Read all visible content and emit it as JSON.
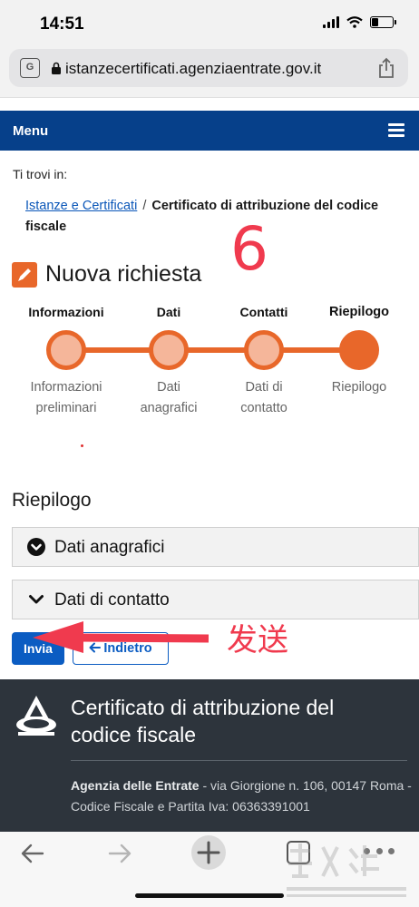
{
  "status_bar": {
    "time": "14:51",
    "battery_level": 0.3
  },
  "browser": {
    "url": "istanzecertificati.agenziaentrate.gov.it",
    "translate_icon": "translate-icon",
    "lock_icon": "lock-icon",
    "share_icon": "share-icon"
  },
  "menu": {
    "label": "Menu",
    "icon": "hamburger-icon"
  },
  "breadcrumb": {
    "intro": "Ti trovi in:",
    "link": "Istanze e Certificati",
    "separator": "/",
    "current": "Certificato di attribuzione del codice fiscale"
  },
  "annotations": {
    "step_number": "6",
    "send_note": "发送"
  },
  "page": {
    "title": "Nuova richiesta",
    "title_icon": "pencil-icon"
  },
  "stepper": {
    "steps": [
      {
        "title": "Informazioni",
        "subtitle_1": "Informazioni",
        "subtitle_2": "preliminari"
      },
      {
        "title": "Dati",
        "subtitle_1": "Dati",
        "subtitle_2": "anagrafici"
      },
      {
        "title": "Contatti",
        "subtitle_1": "Dati di",
        "subtitle_2": "contatto"
      },
      {
        "title": "Riepilogo",
        "subtitle_1": "Riepilogo",
        "subtitle_2": ""
      }
    ],
    "active_step": 4
  },
  "summary": {
    "title": "Riepilogo",
    "sections": [
      {
        "label": "Dati anagrafici",
        "icon": "circle-chevron-down-icon"
      },
      {
        "label": "Dati di contatto",
        "icon": "chevron-down-icon"
      }
    ]
  },
  "actions": {
    "submit": "Invia",
    "back": "Indietro",
    "back_icon": "arrow-left-icon"
  },
  "footer": {
    "title": "Certificato di attribuzione del codice fiscale",
    "org": "Agenzia delle Entrate",
    "address": " - via Giorgione n. 106, 00147 Roma - Codice Fiscale e Partita Iva: 06363391001"
  },
  "colors": {
    "accent": "#e8672a",
    "nav_blue": "#06408a",
    "link": "#0a56b8",
    "button": "#0b5cc2",
    "footer": "#2d343c",
    "annotation": "#f03a4e"
  }
}
